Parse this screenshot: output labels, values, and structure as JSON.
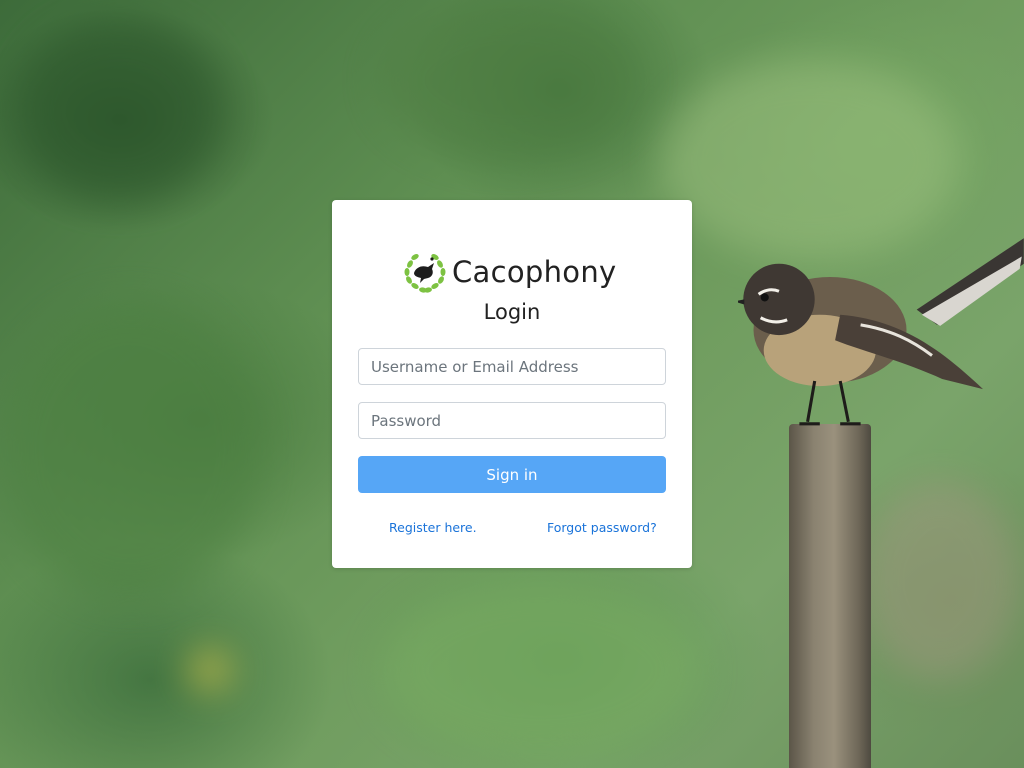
{
  "brand": {
    "name": "Cacophony",
    "logo_icon": "bird-in-leaf-wreath-icon",
    "accent": "#7dc242"
  },
  "login": {
    "title": "Login",
    "username_placeholder": "Username or Email Address",
    "password_placeholder": "Password",
    "signin_label": "Sign in",
    "signin_color": "#56a6f6",
    "register_label": "Register here.",
    "forgot_label": "Forgot password?",
    "link_color": "#1a73d9"
  },
  "background": {
    "description_icon": "fantail-bird-photo"
  }
}
